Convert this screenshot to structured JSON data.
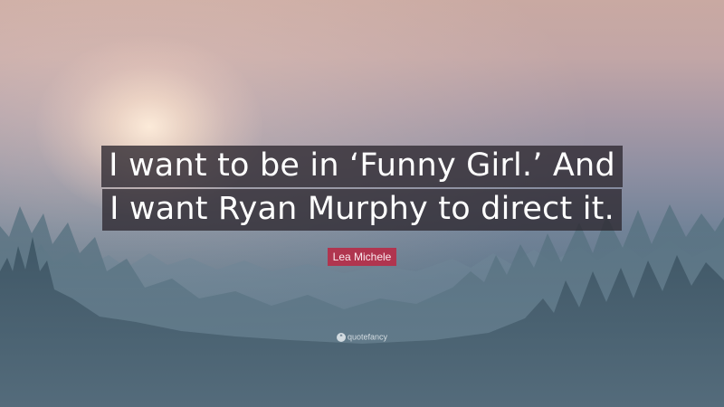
{
  "quote": {
    "lines": [
      "I want to be in ‘Funny Girl.’ And",
      "I want Ryan Murphy to direct it."
    ]
  },
  "author": "Lea Michele",
  "brand": {
    "icon": "quote-mark-icon",
    "icon_glyph": "❝",
    "name": "quotefancy"
  },
  "colors": {
    "author_badge": "#b0354f",
    "quote_box": "#2d2830"
  }
}
